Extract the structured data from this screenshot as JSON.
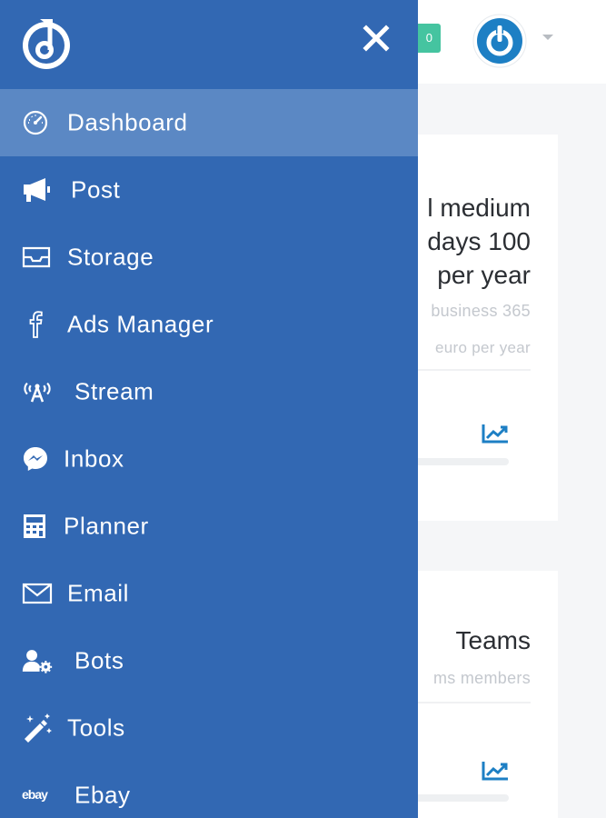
{
  "header": {
    "notification_count": "0"
  },
  "cards": [
    {
      "title_lines": [
        "l medium",
        "days 100",
        "per year"
      ],
      "sub_a": "business 365",
      "sub_b": "euro per year"
    },
    {
      "title_lines": [
        "Teams"
      ],
      "sub_a": "ms members"
    }
  ],
  "sidebar": {
    "items": [
      {
        "label": "Dashboard",
        "icon": "dashboard-gauge-icon",
        "active": true
      },
      {
        "label": "Post",
        "icon": "megaphone-icon"
      },
      {
        "label": "Storage",
        "icon": "inbox-tray-icon"
      },
      {
        "label": "Ads Manager",
        "icon": "facebook-icon"
      },
      {
        "label": "Stream",
        "icon": "broadcast-tower-icon"
      },
      {
        "label": "Inbox",
        "icon": "messenger-icon"
      },
      {
        "label": "Planner",
        "icon": "calculator-icon"
      },
      {
        "label": "Email",
        "icon": "envelope-icon"
      },
      {
        "label": "Bots",
        "icon": "users-cog-icon"
      },
      {
        "label": "Tools",
        "icon": "magic-wand-icon"
      },
      {
        "label": "Ebay",
        "icon": "ebay-icon"
      }
    ]
  },
  "colors": {
    "sidebar_bg": "#3268b3",
    "active_item_bg": "#5b88c4",
    "accent_blue": "#1d7fc4",
    "badge_green": "#45c4a0"
  }
}
